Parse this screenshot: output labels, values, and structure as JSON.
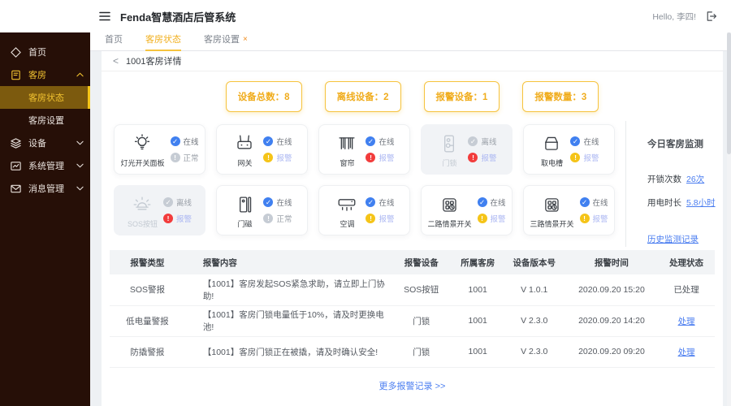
{
  "header": {
    "title": "Fenda智慧酒店后管系统",
    "greeting": "Hello, 李四!"
  },
  "sidebar": {
    "items": [
      {
        "label": "首页",
        "icon": "home-icon",
        "chevron": null,
        "highlight": false,
        "children": []
      },
      {
        "label": "客房",
        "icon": "room-icon",
        "chevron": "up",
        "highlight": true,
        "children": [
          {
            "label": "客房状态",
            "active": true
          },
          {
            "label": "客房设置",
            "active": false
          }
        ]
      },
      {
        "label": "设备",
        "icon": "device-icon",
        "chevron": "down",
        "highlight": false,
        "children": []
      },
      {
        "label": "系统管理",
        "icon": "system-icon",
        "chevron": "down",
        "highlight": false,
        "children": []
      },
      {
        "label": "消息管理",
        "icon": "message-icon",
        "chevron": "down",
        "highlight": false,
        "children": []
      }
    ]
  },
  "tabs": [
    {
      "label": "首页",
      "active": false,
      "closable": false
    },
    {
      "label": "客房状态",
      "active": true,
      "closable": false
    },
    {
      "label": "客房设置",
      "active": false,
      "closable": true
    }
  ],
  "breadcrumb": {
    "back": "<",
    "title": "1001客房详情"
  },
  "stats": [
    {
      "label": "设备总数",
      "value": "8"
    },
    {
      "label": "离线设备",
      "value": "2"
    },
    {
      "label": "报警设备",
      "value": "1"
    },
    {
      "label": "报警数量",
      "value": "3"
    }
  ],
  "devices": [
    {
      "name": "灯光开关面板",
      "icon": "light-panel-icon",
      "offline": false,
      "statuses": [
        {
          "text": "在线",
          "type": "online"
        },
        {
          "text": "正常",
          "type": "normal"
        }
      ]
    },
    {
      "name": "网关",
      "icon": "gateway-icon",
      "offline": false,
      "statuses": [
        {
          "text": "在线",
          "type": "online"
        },
        {
          "text": "报警",
          "type": "warn"
        }
      ]
    },
    {
      "name": "窗帘",
      "icon": "curtain-icon",
      "offline": false,
      "statuses": [
        {
          "text": "在线",
          "type": "online"
        },
        {
          "text": "报警",
          "type": "danger"
        }
      ]
    },
    {
      "name": "门锁",
      "icon": "door-lock-icon",
      "offline": true,
      "statuses": [
        {
          "text": "离线",
          "type": "offline"
        },
        {
          "text": "报警",
          "type": "danger"
        }
      ]
    },
    {
      "name": "取电槽",
      "icon": "power-slot-icon",
      "offline": false,
      "statuses": [
        {
          "text": "在线",
          "type": "online"
        },
        {
          "text": "报警",
          "type": "warn"
        }
      ]
    },
    {
      "name": "SOS按钮",
      "icon": "sos-icon",
      "offline": true,
      "statuses": [
        {
          "text": "离线",
          "type": "offline"
        },
        {
          "text": "报警",
          "type": "danger"
        }
      ]
    },
    {
      "name": "门磁",
      "icon": "door-sensor-icon",
      "offline": false,
      "statuses": [
        {
          "text": "在线",
          "type": "online"
        },
        {
          "text": "正常",
          "type": "normal"
        }
      ]
    },
    {
      "name": "空调",
      "icon": "air-conditioner-icon",
      "offline": false,
      "statuses": [
        {
          "text": "在线",
          "type": "online"
        },
        {
          "text": "报警",
          "type": "warn"
        }
      ]
    },
    {
      "name": "二路情景开关",
      "icon": "scene-switch-icon",
      "offline": false,
      "statuses": [
        {
          "text": "在线",
          "type": "online"
        },
        {
          "text": "报警",
          "type": "warn"
        }
      ]
    },
    {
      "name": "三路情景开关",
      "icon": "scene-switch-icon",
      "offline": false,
      "statuses": [
        {
          "text": "在线",
          "type": "online"
        },
        {
          "text": "报警",
          "type": "warn"
        }
      ]
    }
  ],
  "monitor": {
    "title": "今日客房监测",
    "rows": [
      {
        "label": "开锁次数",
        "value": "26次"
      },
      {
        "label": "用电时长",
        "value": "5.8小时"
      }
    ],
    "history_link": "历史监测记录"
  },
  "alarm_table": {
    "headers": [
      "报警类型",
      "报警内容",
      "报警设备",
      "所属客房",
      "设备版本号",
      "报警时间",
      "处理状态"
    ],
    "rows": [
      {
        "type": "SOS警报",
        "content": "【1001】客房发起SOS紧急求助，请立即上门协助!",
        "device": "SOS按钮",
        "room": "1001",
        "version": "V 1.0.1",
        "time": "2020.09.20 15:20",
        "state": "已处理",
        "state_is_link": false
      },
      {
        "type": "低电量警报",
        "content": "【1001】客房门锁电量低于10%，请及时更换电池!",
        "device": "门锁",
        "room": "1001",
        "version": "V 2.3.0",
        "time": "2020.09.20 14:20",
        "state": "处理",
        "state_is_link": true
      },
      {
        "type": "防撬警报",
        "content": "【1001】客房门锁正在被撬，请及时确认安全!",
        "device": "门锁",
        "room": "1001",
        "version": "V 2.3.0",
        "time": "2020.09.20 09:20",
        "state": "处理",
        "state_is_link": true
      }
    ]
  },
  "footer": {
    "more_label": "更多报警记录",
    "arrows": ">>"
  },
  "colors": {
    "accent_yellow": "#f0ac1c",
    "badge_border": "#f6c33e",
    "link_blue": "#4a7df0",
    "online_blue": "#4080f0",
    "alarm_red": "#f23c3c",
    "warn_yellow": "#f5c418",
    "offline_gray": "#c6ccd4",
    "alarm_text_blue": "#a9b5f2",
    "sidebar_bg": "#260f07",
    "sidebar_active_bg": "#7c5a0e",
    "sidebar_active_text": "#f2c330",
    "table_header_bg": "#f2f4f6"
  }
}
